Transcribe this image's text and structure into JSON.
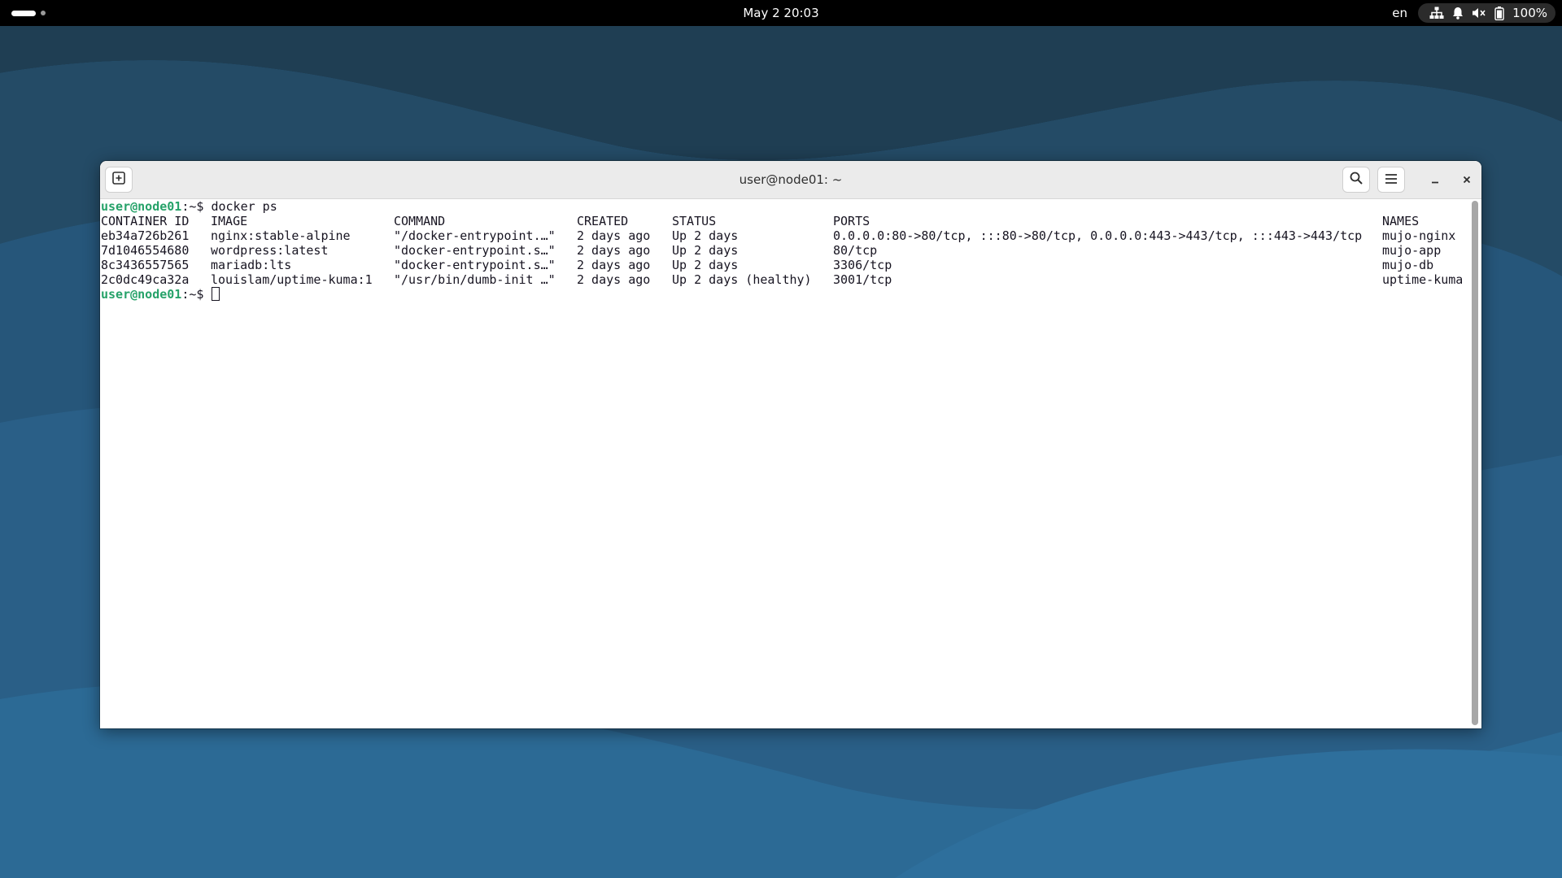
{
  "topbar": {
    "clock": "May 2  20:03",
    "language": "en",
    "battery": "100%"
  },
  "window": {
    "title": "user@node01: ~"
  },
  "terminal": {
    "prompt_user": "user@node01",
    "prompt_rest": ":~$ ",
    "command": "docker ps",
    "columns": [
      "CONTAINER ID",
      "IMAGE",
      "COMMAND",
      "CREATED",
      "STATUS",
      "PORTS",
      "NAMES"
    ],
    "rows": [
      [
        "eb34a726b261",
        "nginx:stable-alpine",
        "\"/docker-entrypoint.…\"",
        "2 days ago",
        "Up 2 days",
        "0.0.0.0:80->80/tcp, :::80->80/tcp, 0.0.0.0:443->443/tcp, :::443->443/tcp",
        "mujo-nginx"
      ],
      [
        "7d1046554680",
        "wordpress:latest",
        "\"docker-entrypoint.s…\"",
        "2 days ago",
        "Up 2 days",
        "80/tcp",
        "mujo-app"
      ],
      [
        "8c3436557565",
        "mariadb:lts",
        "\"docker-entrypoint.s…\"",
        "2 days ago",
        "Up 2 days",
        "3306/tcp",
        "mujo-db"
      ],
      [
        "2c0dc49ca32a",
        "louislam/uptime-kuma:1",
        "\"/usr/bin/dumb-init …\"",
        "2 days ago",
        "Up 2 days (healthy)",
        "3001/tcp",
        "uptime-kuma"
      ]
    ]
  },
  "icons": {
    "new_tab": "new-tab-icon",
    "search": "search-icon",
    "menu": "hamburger-menu-icon",
    "minimize": "minimize-icon",
    "close": "close-icon",
    "network": "network-icon",
    "notifications": "bell-icon",
    "volume": "volume-muted-icon",
    "battery": "battery-icon"
  },
  "colors": {
    "desktop": "#2a5e86",
    "topbar": "#000000",
    "headerbar": "#ebebeb",
    "terminal_bg": "#ffffff",
    "terminal_fg": "#171421",
    "prompt": "#26a269"
  }
}
